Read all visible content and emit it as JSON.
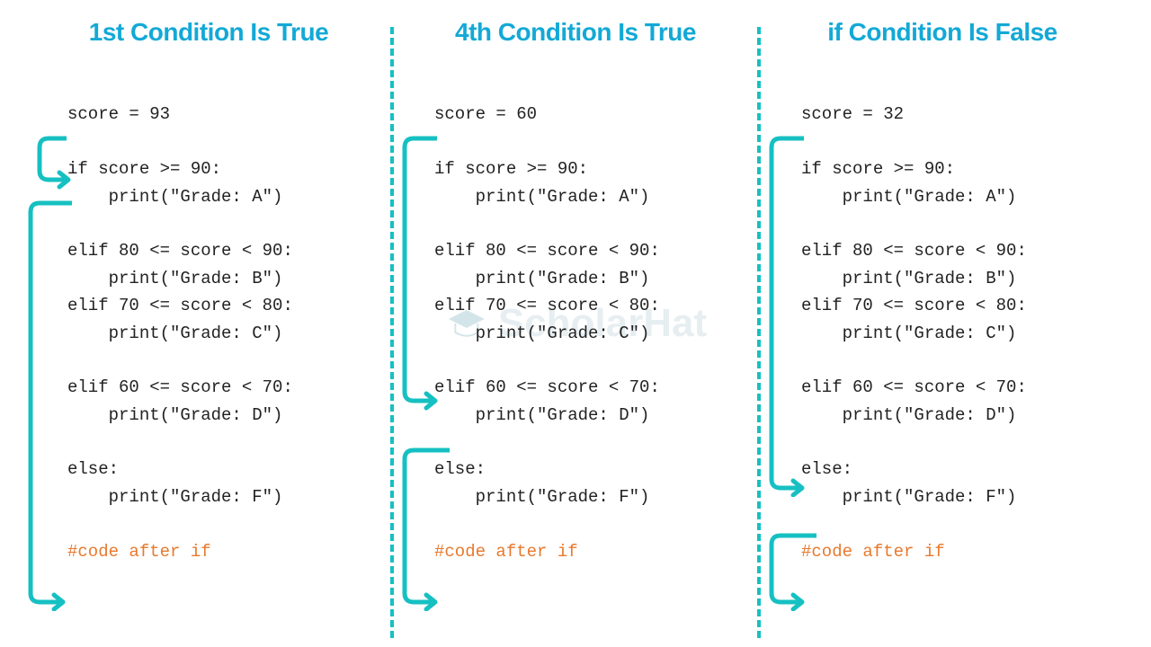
{
  "watermark": "ScholarHat",
  "columns": [
    {
      "title": "1st Condition Is True",
      "score_line": "score = 93",
      "code_lines": [
        "if score >= 90:",
        "    print(\"Grade: A\")",
        "",
        "elif 80 <= score < 90:",
        "    print(\"Grade: B\")",
        "elif 70 <= score < 80:",
        "    print(\"Grade: C\")",
        "",
        "elif 60 <= score < 70:",
        "    print(\"Grade: D\")",
        "",
        "else:",
        "    print(\"Grade: F\")"
      ],
      "after": "#code after if"
    },
    {
      "title": "4th Condition Is True",
      "score_line": "score = 60",
      "code_lines": [
        "if score >= 90:",
        "    print(\"Grade: A\")",
        "",
        "elif 80 <= score < 90:",
        "    print(\"Grade: B\")",
        "elif 70 <= score < 80:",
        "    print(\"Grade: C\")",
        "",
        "elif 60 <= score < 70:",
        "    print(\"Grade: D\")",
        "",
        "else:",
        "    print(\"Grade: F\")"
      ],
      "after": "#code after if"
    },
    {
      "title": "if Condition Is False",
      "score_line": "score = 32",
      "code_lines": [
        "if score >= 90:",
        "    print(\"Grade: A\")",
        "",
        "elif 80 <= score < 90:",
        "    print(\"Grade: B\")",
        "elif 70 <= score < 80:",
        "    print(\"Grade: C\")",
        "",
        "elif 60 <= score < 70:",
        "    print(\"Grade: D\")",
        "",
        "else:",
        "    print(\"Grade: F\")"
      ],
      "after": "#code after if"
    }
  ],
  "chart_data": {
    "type": "table",
    "description": "Python if-elif-else flow diagram showing three scenarios",
    "scenarios": [
      {
        "label": "1st Condition Is True",
        "score": 93,
        "matched_branch": "if score >= 90",
        "output": "Grade: A"
      },
      {
        "label": "4th Condition Is True",
        "score": 60,
        "matched_branch": "elif 60 <= score < 70",
        "output": "Grade: D"
      },
      {
        "label": "if Condition Is False",
        "score": 32,
        "matched_branch": "else",
        "output": "Grade: F"
      }
    ],
    "branches": [
      {
        "condition": "score >= 90",
        "grade": "A"
      },
      {
        "condition": "80 <= score < 90",
        "grade": "B"
      },
      {
        "condition": "70 <= score < 80",
        "grade": "C"
      },
      {
        "condition": "60 <= score < 70",
        "grade": "D"
      },
      {
        "condition": "else",
        "grade": "F"
      }
    ]
  }
}
